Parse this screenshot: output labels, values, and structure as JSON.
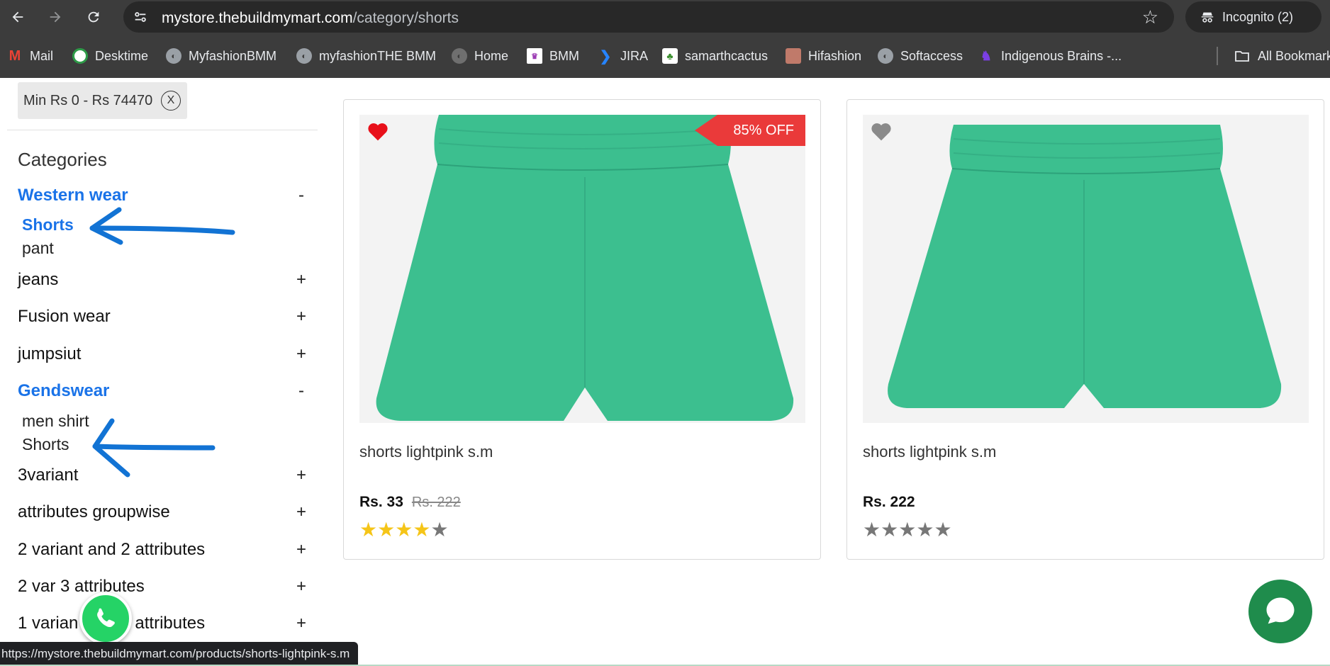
{
  "browser": {
    "url_host": "mystore.thebuildmymart.com",
    "url_path": "/category/shorts",
    "incognito_label": "Incognito (2)",
    "bookmarks": [
      {
        "label": "Mail",
        "icon": "gmail-icon",
        "color": "#ea4335"
      },
      {
        "label": "Desktime",
        "icon": "desktime-icon",
        "color": "#2e9b48"
      },
      {
        "label": "MyfashionBMM",
        "icon": "globe-icon",
        "color": "#9aa0a6"
      },
      {
        "label": "myfashionTHE BMM",
        "icon": "globe-icon",
        "color": "#9aa0a6"
      },
      {
        "label": "Home",
        "icon": "globe-icon",
        "color": "#9aa0a6"
      },
      {
        "label": "BMM",
        "icon": "bmm-icon",
        "color": "#9b3bb3"
      },
      {
        "label": "JIRA",
        "icon": "jira-icon",
        "color": "#2684ff"
      },
      {
        "label": "samarthcactus",
        "icon": "cactus-icon",
        "color": "#3a8f2d"
      },
      {
        "label": "Hifashion",
        "icon": "hifashion-icon",
        "color": "#c07a6a"
      },
      {
        "label": "Softaccess",
        "icon": "globe-icon",
        "color": "#9aa0a6"
      },
      {
        "label": "Indigenous Brains -...",
        "icon": "indigenous-icon",
        "color": "#7b3fe4"
      }
    ],
    "all_bookmarks_label": "All Bookmarks",
    "status_url": "https://mystore.thebuildmymart.com/products/shorts-lightpink-s.m"
  },
  "filter": {
    "chip_label": "Min Rs 0 - Rs 74470",
    "chip_close": "X"
  },
  "sidebar": {
    "heading": "Categories",
    "categories": [
      {
        "label": "Western wear",
        "toggle": "-",
        "active": true
      },
      {
        "label": "jeans",
        "toggle": "+"
      },
      {
        "label": "Fusion wear",
        "toggle": "+"
      },
      {
        "label": "jumpsiut",
        "toggle": "+"
      },
      {
        "label": "Gendswear",
        "toggle": "-",
        "active": true
      },
      {
        "label": "3variant",
        "toggle": "+"
      },
      {
        "label": "attributes groupwise",
        "toggle": "+"
      },
      {
        "label": "2 variant and 2 attributes",
        "toggle": "+"
      },
      {
        "label": "2 var 3 attributes",
        "toggle": "+"
      },
      {
        "label": "1 varian",
        "label_suffix": "attributes",
        "toggle": "+"
      }
    ],
    "western_sub": [
      {
        "label": "Shorts",
        "active": true
      },
      {
        "label": "pant"
      }
    ],
    "gendswear_sub": [
      {
        "label": "men shirt"
      },
      {
        "label": "Shorts"
      }
    ]
  },
  "products": [
    {
      "title": "shorts lightpink s.m",
      "price": "Rs. 33",
      "mrp": "Rs. 222",
      "discount_badge": "85% OFF",
      "wishlisted": true,
      "rating": 4,
      "rating_max": 5,
      "heart_color": "#e8101a"
    },
    {
      "title": "shorts lightpink s.m",
      "price": "Rs. 222",
      "wishlisted": false,
      "rating": 0,
      "rating_max": 5,
      "heart_color": "#8a8a8a"
    }
  ],
  "colors": {
    "accent_blue": "#1a73e8",
    "product_green": "#3cbf8f",
    "badge_red": "#ea3a3a",
    "whatsapp_green": "#25d366",
    "chat_green": "#1f8c4c"
  }
}
